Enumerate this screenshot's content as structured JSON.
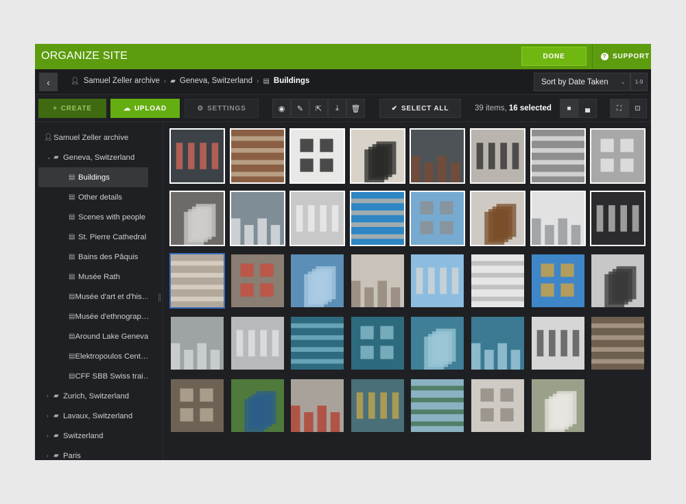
{
  "app": {
    "title": "ORGANIZE SITE",
    "done_label": "DONE",
    "support_label": "SUPPORT",
    "accent": "#5c9c0e"
  },
  "breadcrumb": [
    {
      "label": "Samuel Zeller archive",
      "icon": "user-icon"
    },
    {
      "label": "Geneva, Switzerland",
      "icon": "folder-open-icon"
    },
    {
      "label": "Buildings",
      "icon": "gallery-icon"
    }
  ],
  "sort": {
    "value": "Sort by Date Taken",
    "range": "1-9"
  },
  "toolbar": {
    "create_label": "CREATE",
    "upload_label": "UPLOAD",
    "settings_label": "SETTINGS",
    "select_all_label": "SELECT ALL",
    "count_prefix": "39 items, ",
    "count_selected": "16 selected"
  },
  "sidebar": [
    {
      "label": "Samuel Zeller archive",
      "icon": "user-icon",
      "level": 0,
      "chevron": "",
      "active": false
    },
    {
      "label": "Geneva, Switzerland",
      "icon": "folder-open-icon",
      "level": 1,
      "chevron": "down",
      "active": false
    },
    {
      "label": "Buildings",
      "icon": "gallery-icon",
      "level": 2,
      "chevron": "",
      "active": true
    },
    {
      "label": "Other details",
      "icon": "gallery-icon",
      "level": 2,
      "chevron": "",
      "active": false
    },
    {
      "label": "Scenes with people",
      "icon": "gallery-icon",
      "level": 2,
      "chevron": "",
      "active": false
    },
    {
      "label": "St. Pierre Cathedral",
      "icon": "gallery-icon",
      "level": 2,
      "chevron": "",
      "active": false
    },
    {
      "label": "Bains des Pâquis",
      "icon": "gallery-icon",
      "level": 2,
      "chevron": "",
      "active": false
    },
    {
      "label": "Musée Rath",
      "icon": "gallery-icon",
      "level": 2,
      "chevron": "",
      "active": false
    },
    {
      "label": "Musée d'art et d'his…",
      "icon": "gallery-icon",
      "level": 2,
      "chevron": "",
      "active": false
    },
    {
      "label": "Musée d'ethnograp…",
      "icon": "gallery-icon",
      "level": 2,
      "chevron": "",
      "active": false
    },
    {
      "label": "Around Lake Geneva",
      "icon": "gallery-icon",
      "level": 2,
      "chevron": "",
      "active": false
    },
    {
      "label": "Elektropoulos Cent…",
      "icon": "gallery-icon",
      "level": 2,
      "chevron": "",
      "active": false
    },
    {
      "label": "CFF SBB Swiss trai…",
      "icon": "gallery-icon",
      "level": 2,
      "chevron": "",
      "active": false
    },
    {
      "label": "Zurich, Switzerland",
      "icon": "folder-icon",
      "level": 1,
      "chevron": "right",
      "active": false
    },
    {
      "label": "Lavaux, Switzerland",
      "icon": "folder-icon",
      "level": 1,
      "chevron": "right",
      "active": false
    },
    {
      "label": "Switzerland",
      "icon": "folder-icon",
      "level": 1,
      "chevron": "right",
      "active": false
    },
    {
      "label": "Paris",
      "icon": "folder-icon",
      "level": 1,
      "chevron": "right",
      "active": false
    }
  ],
  "photos": [
    {
      "bg": "#3c4247",
      "fg": "#d66a5a",
      "sel": true
    },
    {
      "bg": "#8a5f44",
      "fg": "#c6b39a",
      "sel": true
    },
    {
      "bg": "#e8e8e6",
      "fg": "#151515",
      "sel": true
    },
    {
      "bg": "#d8d2c8",
      "fg": "#2a2a2a",
      "sel": true
    },
    {
      "bg": "#4d5356",
      "fg": "#7b4a33",
      "sel": true
    },
    {
      "bg": "#b9b4ad",
      "fg": "#2a2a2a",
      "sel": true
    },
    {
      "bg": "#8e8e8e",
      "fg": "#e6e6e6",
      "sel": true
    },
    {
      "bg": "#a8a8a8",
      "fg": "#ececec",
      "sel": true
    },
    {
      "bg": "#6d6a68",
      "fg": "#cfcdcb",
      "sel": true
    },
    {
      "bg": "#7f8d96",
      "fg": "#e4e7e8",
      "sel": true
    },
    {
      "bg": "#c8c8c8",
      "fg": "#efefef",
      "sel": true
    },
    {
      "bg": "#2e86c4",
      "fg": "#c5b8aa",
      "sel": true
    },
    {
      "bg": "#77aad0",
      "fg": "#8d8d8d",
      "sel": true
    },
    {
      "bg": "#cfc9c3",
      "fg": "#7a4d2a",
      "sel": true
    },
    {
      "bg": "#e2e2e2",
      "fg": "#8c9196",
      "sel": true
    },
    {
      "bg": "#2b2b2d",
      "fg": "#c3c3c3",
      "sel": true
    },
    {
      "bg": "#b2a99a",
      "fg": "#e0d8cc",
      "sel": false,
      "focus": true
    },
    {
      "bg": "#8a7d72",
      "fg": "#c94b3c",
      "sel": false
    },
    {
      "bg": "#5c8fb7",
      "fg": "#a9cbe3",
      "sel": false
    },
    {
      "bg": "#c9c2b9",
      "fg": "#8d7f73",
      "sel": false
    },
    {
      "bg": "#8cbde0",
      "fg": "#d8d8d4",
      "sel": false
    },
    {
      "bg": "#e6e6e6",
      "fg": "#b4b4b4",
      "sel": false
    },
    {
      "bg": "#3f86c8",
      "fg": "#d9a43a",
      "sel": false
    },
    {
      "bg": "#c7c7c7",
      "fg": "#3a3a3a",
      "sel": false
    },
    {
      "bg": "#9ea3a6",
      "fg": "#d7dadb",
      "sel": false
    },
    {
      "bg": "#b7b9bb",
      "fg": "#e4e5e6",
      "sel": false
    },
    {
      "bg": "#2f6b80",
      "fg": "#7bb4c8",
      "sel": false
    },
    {
      "bg": "#2d6a7e",
      "fg": "#8fc1d2",
      "sel": false
    },
    {
      "bg": "#3f7f98",
      "fg": "#9bc7d6",
      "sel": false
    },
    {
      "bg": "#3b7a92",
      "fg": "#a8cfdd",
      "sel": false
    },
    {
      "bg": "#d6d6d6",
      "fg": "#4a4a4a",
      "sel": false
    },
    {
      "bg": "#6e5f4f",
      "fg": "#b3a38f",
      "sel": false
    },
    {
      "bg": "#6d6254",
      "fg": "#bdb09e",
      "sel": false
    },
    {
      "bg": "#4f7a3c",
      "fg": "#2c5e8a",
      "sel": false
    },
    {
      "bg": "#a8a29b",
      "fg": "#b33a2a",
      "sel": false
    },
    {
      "bg": "#4a6f78",
      "fg": "#c9a84a",
      "sel": false
    },
    {
      "bg": "#8ab2c2",
      "fg": "#3d6e4a",
      "sel": false
    },
    {
      "bg": "#cfcbc4",
      "fg": "#8b8479",
      "sel": false
    },
    {
      "bg": "#9aa18a",
      "fg": "#e8e6e1",
      "sel": false
    }
  ]
}
